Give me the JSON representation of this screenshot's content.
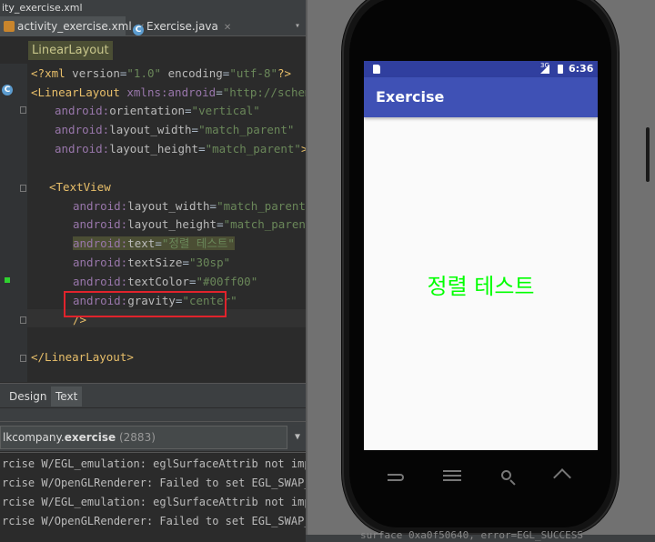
{
  "window": {
    "title": "ity_exercise.xml"
  },
  "tabs": [
    {
      "label": "activity_exercise.xml",
      "icon": "xml-file-icon",
      "active": true
    },
    {
      "label": "Exercise.java",
      "icon": "java-class-icon",
      "icon_letter": "C",
      "active": false
    }
  ],
  "breadcrumb": "LinearLayout",
  "gutter": {
    "class_marker_letter": "C"
  },
  "code": {
    "line1": {
      "open": "<?",
      "tag": "xml",
      "sp1": " ",
      "a1": "version",
      "eq1": "=",
      "v1": "\"1.0\"",
      "sp2": " ",
      "a2": "encoding",
      "eq2": "=",
      "v2": "\"utf-8\"",
      "close": "?>"
    },
    "line2": {
      "open": "<",
      "tag": "LinearLayout",
      "sp": " ",
      "ns": "xmlns:android",
      "eq": "=",
      "val": "\"http://schemas.a"
    },
    "line3": {
      "ns": "android:",
      "attr": "orientation",
      "eq": "=",
      "val": "\"vertical\""
    },
    "line4": {
      "ns": "android:",
      "attr": "layout_width",
      "eq": "=",
      "val": "\"match_parent\""
    },
    "line5": {
      "ns": "android:",
      "attr": "layout_height",
      "eq": "=",
      "val": "\"match_parent\"",
      "close": ">"
    },
    "line7": {
      "open": "<",
      "tag": "TextView"
    },
    "line8": {
      "ns": "android:",
      "attr": "layout_width",
      "eq": "=",
      "val": "\"match_parent\""
    },
    "line9": {
      "ns": "android:",
      "attr": "layout_height",
      "eq": "=",
      "val": "\"match_parent\""
    },
    "line10": {
      "ns": "android:",
      "attr": "text",
      "eq": "=",
      "val": "\"정렬 테스트\""
    },
    "line11": {
      "ns": "android:",
      "attr": "textSize",
      "eq": "=",
      "val": "\"30sp\""
    },
    "line12": {
      "ns": "android:",
      "attr": "textColor",
      "eq": "=",
      "val": "\"#00ff00\""
    },
    "line13": {
      "ns": "android:",
      "attr": "gravity",
      "eq": "=",
      "val": "\"center\""
    },
    "line14": {
      "close": "/>"
    },
    "line16": {
      "close": "</LinearLayout>"
    }
  },
  "bottom_tabs": [
    "Design",
    "Text"
  ],
  "logcat": {
    "process_prefix": "lkcompany.",
    "process_bold": "exercise",
    "process_pid": "(2883)",
    "lines": [
      "rcise W/EGL_emulation: eglSurfaceAttrib not impleme",
      "rcise W/OpenGLRenderer: Failed to set EGL_SWAP_BEHA",
      "rcise W/EGL_emulation: eglSurfaceAttrib not impleme",
      "rcise W/OpenGLRenderer: Failed to set EGL_SWAP_BEHA"
    ],
    "footer_fragment": "surface 0xa0f50640, error=EGL_SUCCESS"
  },
  "device": {
    "status_time": "6:36",
    "network_label": "3G",
    "app_title": "Exercise",
    "center_text": "정렬 테스트",
    "text_color": "#00ff00",
    "appbar_color": "#3f51b5",
    "statusbar_color": "#303f9f",
    "nav_keys": [
      "back-icon",
      "menu-icon",
      "search-icon",
      "home-icon"
    ]
  },
  "highlight_color": "#e0232c"
}
